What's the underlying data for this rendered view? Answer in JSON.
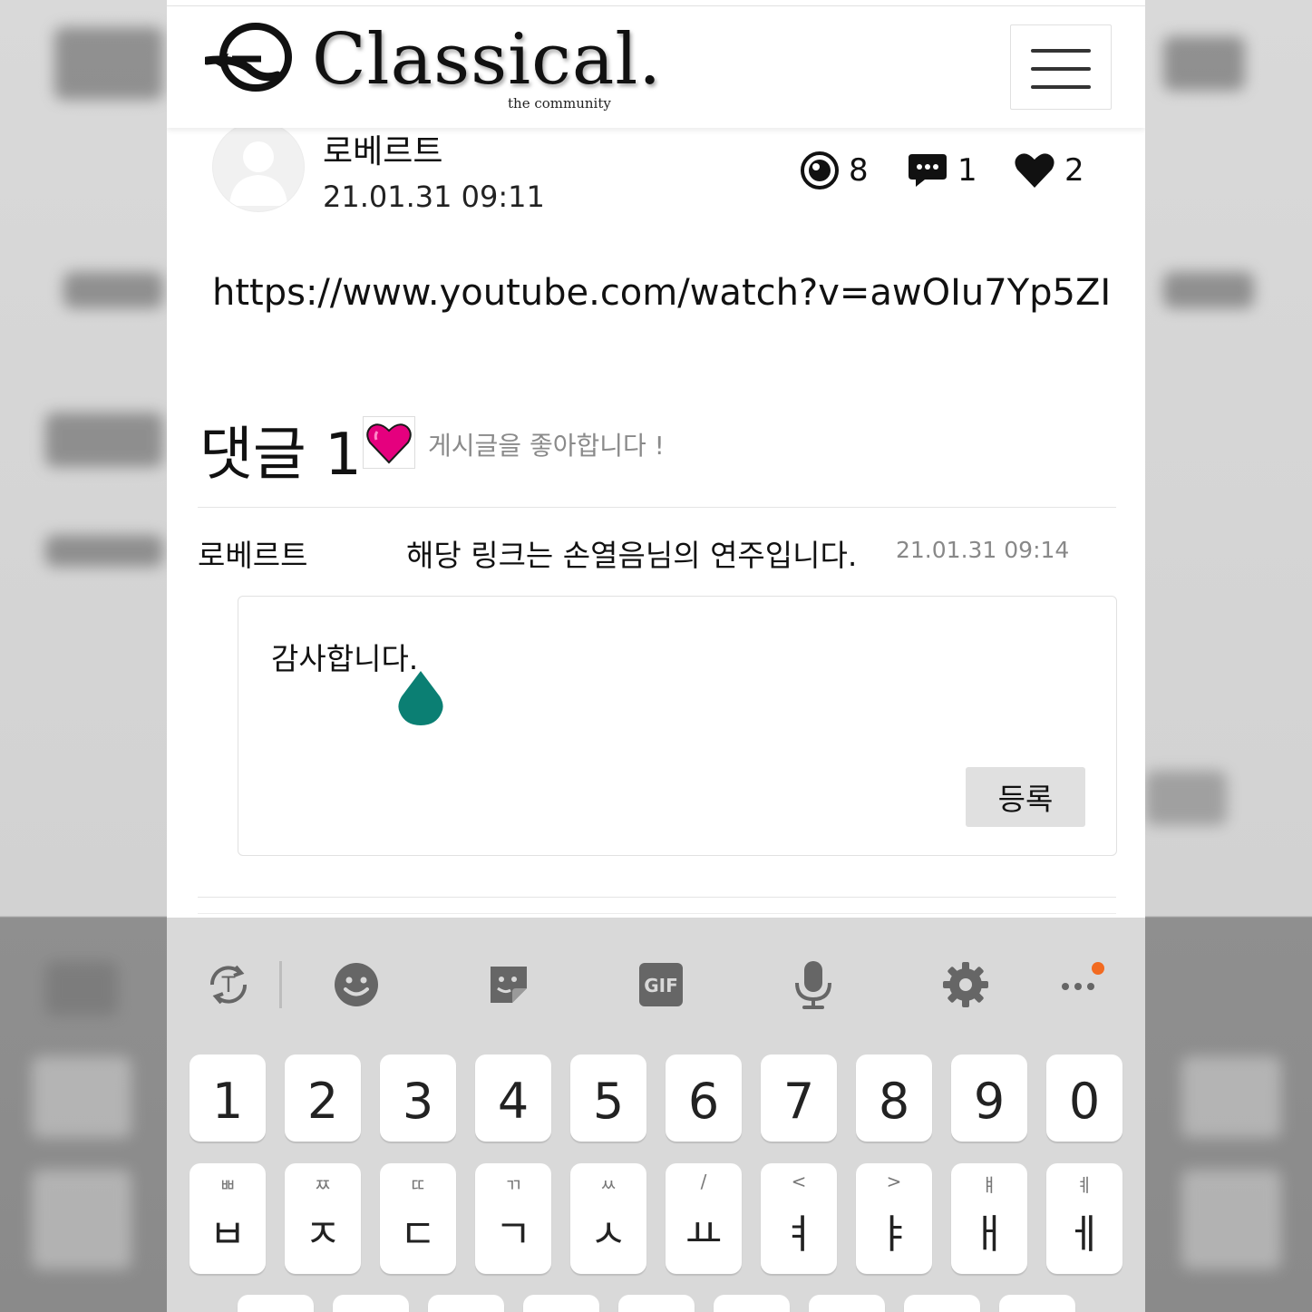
{
  "site": {
    "logo_text": "Classical.",
    "logo_subtitle": "the community"
  },
  "post": {
    "author": "로베르트",
    "timestamp": "21.01.31 09:11",
    "views": "8",
    "comment_count": "1",
    "likes": "2",
    "body_link": "https://www.youtube.com/watch?v=awOIu7Yp5ZI"
  },
  "comments_section": {
    "title": "댓글 1",
    "like_prompt": "게시글을 좋아합니다 !"
  },
  "comment": {
    "author": "로베르트",
    "text": "해당 링크는 손열음님의 연주입니다.",
    "timestamp": "21.01.31 09:14"
  },
  "reply_input": {
    "value": "감사합니다.",
    "submit_label": "등록"
  },
  "keyboard": {
    "toolbar_icons": [
      "translate-icon",
      "emoji-icon",
      "sticker-icon",
      "gif-icon",
      "microphone-icon",
      "settings-icon",
      "more-icon"
    ],
    "gif_label": "GIF",
    "number_row": [
      "1",
      "2",
      "3",
      "4",
      "5",
      "6",
      "7",
      "8",
      "9",
      "0"
    ],
    "hangul_row": [
      {
        "main": "ㅂ",
        "sub": "ㅃ"
      },
      {
        "main": "ㅈ",
        "sub": "ㅉ"
      },
      {
        "main": "ㄷ",
        "sub": "ㄸ"
      },
      {
        "main": "ㄱ",
        "sub": "ㄲ"
      },
      {
        "main": "ㅅ",
        "sub": "ㅆ"
      },
      {
        "main": "ㅛ",
        "sub": "/"
      },
      {
        "main": "ㅕ",
        "sub": "<"
      },
      {
        "main": "ㅑ",
        "sub": ">"
      },
      {
        "main": "ㅐ",
        "sub": "ㅒ"
      },
      {
        "main": "ㅔ",
        "sub": "ㅖ"
      }
    ],
    "accent_color": "#f26b21"
  },
  "colors": {
    "like_heart": "#e5007e",
    "cursor_drop": "#0b7f73",
    "dark": "#111111"
  }
}
